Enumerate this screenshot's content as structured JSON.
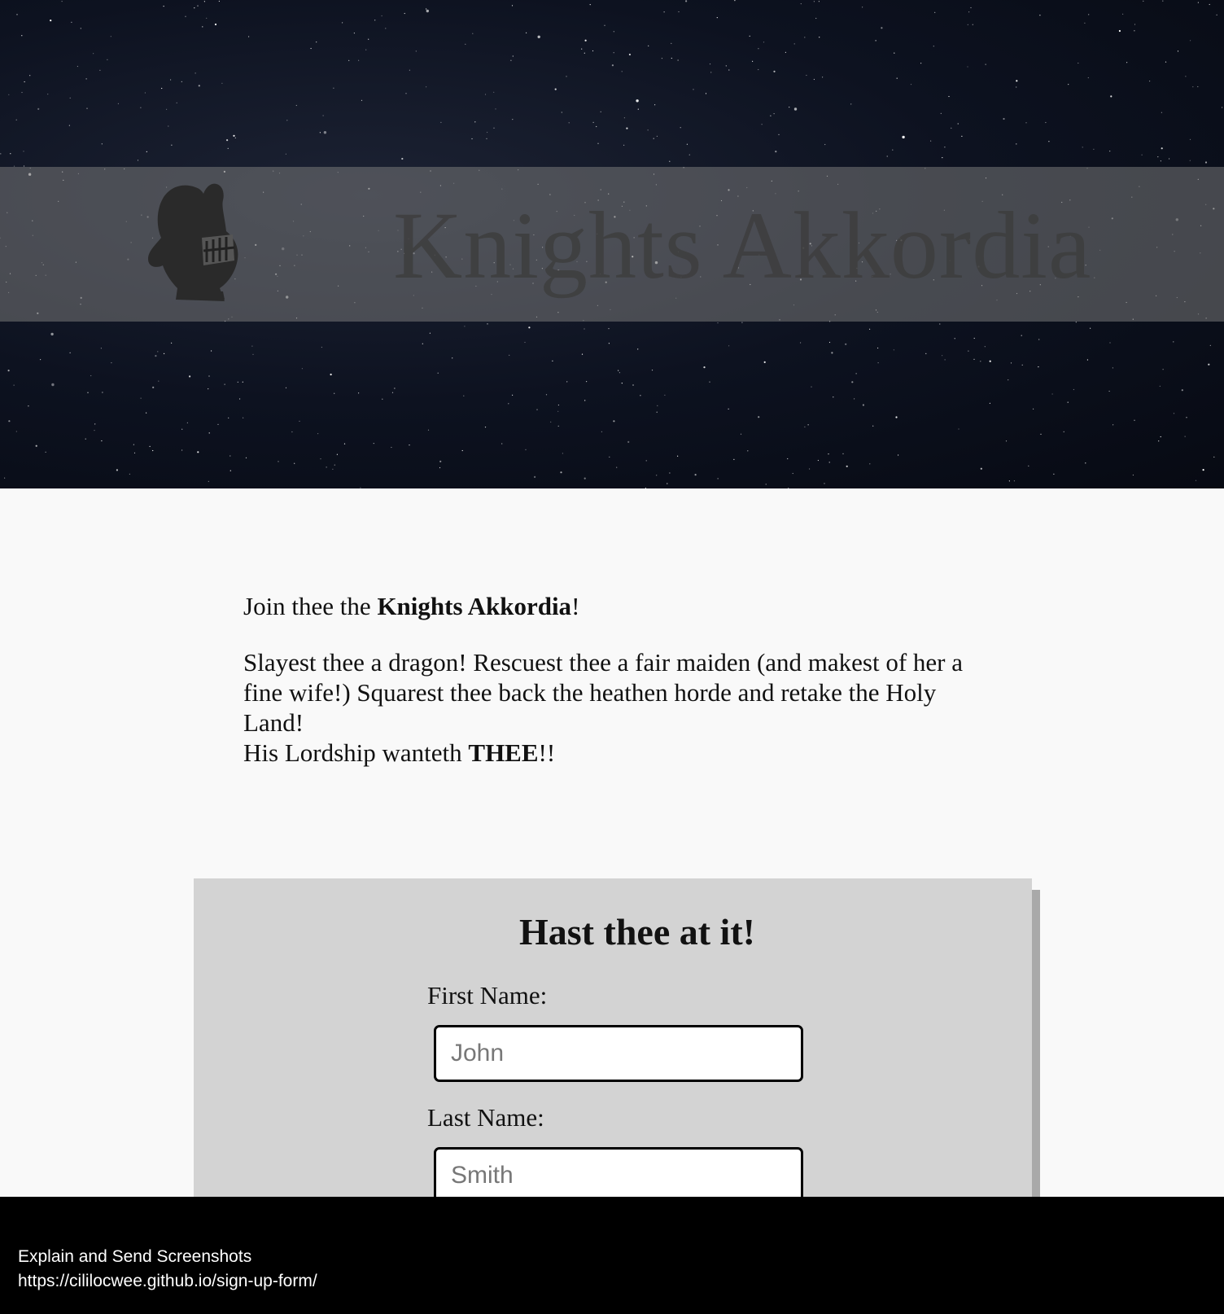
{
  "header": {
    "site_title": "Knights Akkordia",
    "logo_icon": "knight-helmet-icon"
  },
  "intro": {
    "join_prefix": "Join thee the ",
    "join_bold": "Knights Akkordia",
    "join_suffix": "!",
    "body_text": "Slayest thee a dragon! Rescuest thee a fair maiden (and makest of her a fine wife!) Squarest thee back the heathen horde and retake the Holy Land!",
    "lordship_prefix": "His Lordship wanteth ",
    "lordship_bold": "THEE",
    "lordship_suffix": "!!"
  },
  "form": {
    "title": "Hast thee at it!",
    "first_name_label": "First Name:",
    "first_name_placeholder": "John",
    "last_name_label": "Last Name:",
    "last_name_placeholder": "Smith"
  },
  "overlay": {
    "caption": "Explain and Send Screenshots",
    "url": "https://cililocwee.github.io/sign-up-form/"
  },
  "colors": {
    "page_background": "#f9f9f9",
    "card_background": "#d3d3d3",
    "card_shadow": "#a9a9a9",
    "banner": "#787878",
    "overlay_background": "#000000"
  }
}
